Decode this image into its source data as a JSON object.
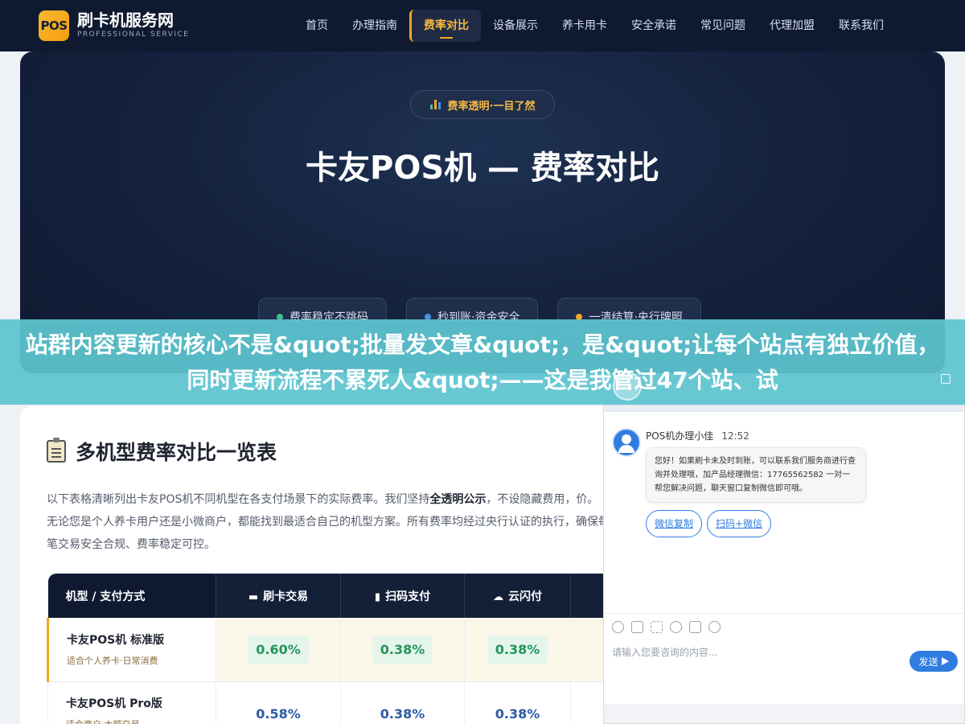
{
  "brand": {
    "badge": "POS",
    "title": "刷卡机服务网",
    "subtitle": "PROFESSIONAL SERVICE",
    "accent": "#f5a623"
  },
  "nav": {
    "items": [
      {
        "label": "首页"
      },
      {
        "label": "办理指南"
      },
      {
        "label": "费率对比"
      },
      {
        "label": "设备展示"
      },
      {
        "label": "养卡用卡"
      },
      {
        "label": "安全承诺"
      },
      {
        "label": "常见问题"
      },
      {
        "label": "代理加盟"
      },
      {
        "label": "联系我们"
      }
    ],
    "active": "费率对比"
  },
  "hero": {
    "badge": "费率透明·一目了然",
    "title": "卡友POS机 — 费率对比",
    "pills": [
      {
        "label": "费率稳定不跳码",
        "color": "#3fbf8a"
      },
      {
        "label": "秒到账·资金安全",
        "color": "#4a90e2"
      },
      {
        "label": "一清结算·央行牌照",
        "color": "#f5a623"
      }
    ]
  },
  "banner": {
    "text": "站群内容更新的核心不是&quot;批量发文章&quot;，是&quot;让每个站点有独立价值，同时更新流程不累死人&quot;——这是我管过47个站、试"
  },
  "section": {
    "title": "多机型费率对比一览表",
    "desc_before": "以下表格清晰列出卡友POS机不同机型在各支付场景下的实际费率。我们坚持",
    "desc_bold": "全透明公示",
    "desc_after": "，不设隐藏费用，价。无论您是个人养卡用户还是小微商户，都能找到最适合自己的机型方案。所有费率均经过央行认证的执行，确保每笔交易安全合规、费率稳定可控。"
  },
  "table": {
    "headers": [
      {
        "label": "机型 / 支付方式",
        "icon": ""
      },
      {
        "label": "刷卡交易",
        "icon": "card-icon"
      },
      {
        "label": "扫码支付",
        "icon": "phone-icon"
      },
      {
        "label": "云闪付",
        "icon": "cloud-icon"
      }
    ],
    "rows": [
      {
        "name": "卡友POS机 标准版",
        "sub": "适合个人养卡·日常消费",
        "rates": [
          "0.60%",
          "0.38%",
          "0.38%"
        ]
      },
      {
        "name": "卡友POS机 Pro版",
        "sub": "适合商户·大额交易",
        "rates": [
          "0.58%",
          "0.38%",
          "0.38%"
        ]
      }
    ]
  },
  "chat": {
    "agent_name": "POS机办理小佳",
    "time": "12:52",
    "message": "您好！如果刷卡未及时到账，可以联系我们服务商进行查询并处理哦，加产品经理微信：17765562582 一对一帮您解决问题，聊天窗口复制微信即可哦。",
    "quick_buttons": [
      "微信复制",
      "扫码+微信"
    ],
    "input_placeholder": "请输入您要咨询的内容...",
    "send_label": "发送",
    "toolbar_icons": [
      "emoji-icon",
      "image-icon",
      "screenshot-icon",
      "rating-icon",
      "voice-icon",
      "link-icon"
    ]
  }
}
